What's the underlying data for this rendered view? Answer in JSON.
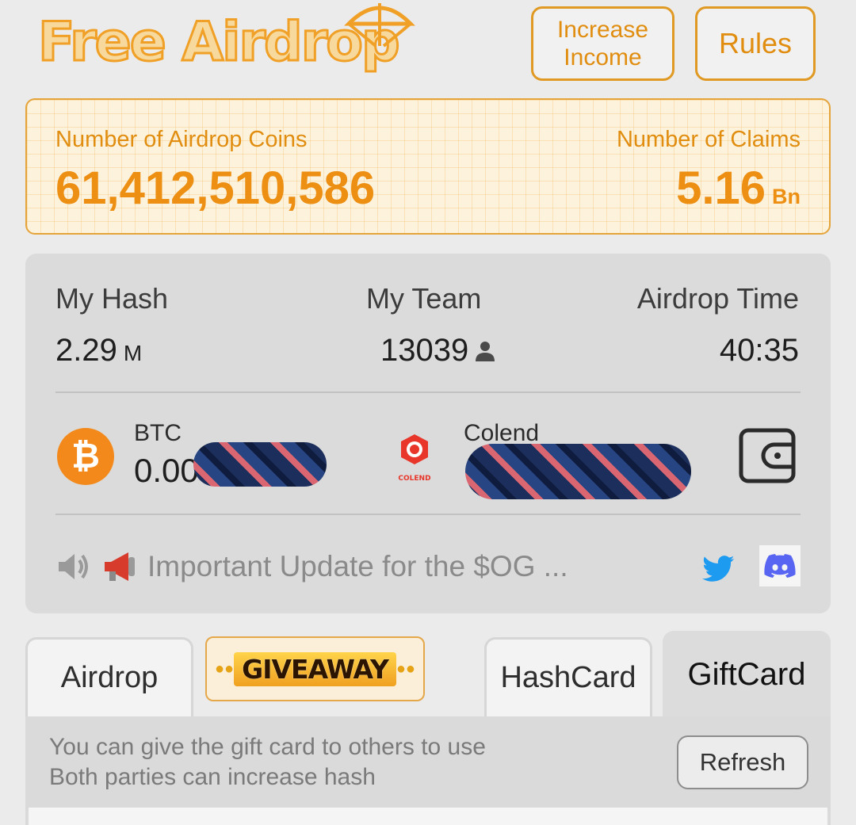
{
  "header": {
    "logo_text": "Free Airdrop",
    "increase_income_line1": "Increase",
    "increase_income_line2": "Income",
    "rules_label": "Rules"
  },
  "stats": {
    "coins_label": "Number of Airdrop Coins",
    "coins_value": "61,412,510,586",
    "claims_label": "Number of Claims",
    "claims_value": "5.16",
    "claims_unit": "Bn"
  },
  "account": {
    "hash_label": "My Hash",
    "hash_value": "2.29",
    "hash_unit": "M",
    "team_label": "My Team",
    "team_value": "13039",
    "time_label": "Airdrop Time",
    "time_value": "40:35"
  },
  "balances": {
    "btc_symbol": "₿",
    "btc_name": "BTC",
    "btc_value_visible": "0.00",
    "colend_name": "Colend",
    "colend_logo_text": "COLEND"
  },
  "notice": {
    "text": "Important Update for the $OG ..."
  },
  "tabs": {
    "airdrop": "Airdrop",
    "giveaway": "GIVEAWAY",
    "hashcard": "HashCard",
    "giftcard": "GiftCard"
  },
  "giftcard": {
    "line1": "You can give the gift card to others to use",
    "line2": "Both parties can increase hash",
    "refresh_label": "Refresh"
  },
  "colors": {
    "accent": "#ec8f12",
    "btc": "#f3891a",
    "twitter": "#1d9bf0",
    "discord": "#5865f2"
  }
}
